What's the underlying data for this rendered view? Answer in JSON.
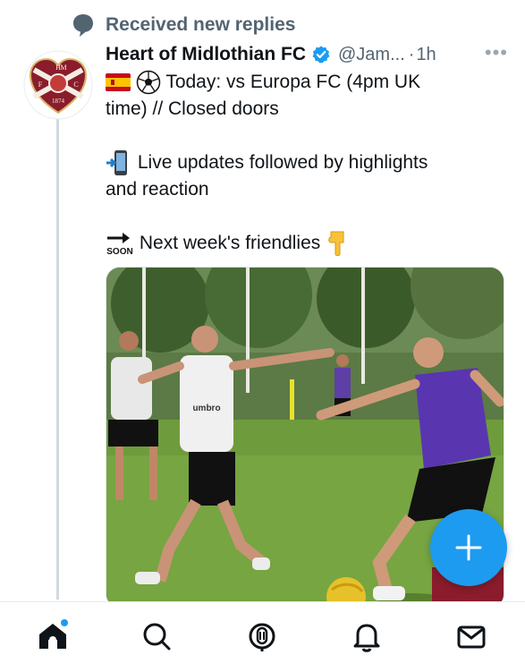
{
  "notification": {
    "text": "Received new replies",
    "icon": "speech-bubble-icon"
  },
  "tweet": {
    "author_name": "Heart of Midlothian FC",
    "verified": true,
    "handle": "@Jam...",
    "time": "1h",
    "separator": "·",
    "more_label": "•••",
    "lines": [
      "Today: vs Europa FC (4pm UK",
      "time) // Closed doors",
      "Live updates followed by highlights",
      "and reaction",
      "Next week's friendlies"
    ],
    "emojis": [
      "spain-flag-icon",
      "soccer-ball-icon",
      "mobile-phone-arrow-icon",
      "soon-arrow-icon",
      "pointing-down-hand-icon"
    ],
    "soon_label": "SOON",
    "media": {
      "description": "Players training on a grass pitch",
      "bib_brand": "umbro"
    }
  },
  "avatar": {
    "crest_letters": [
      "H",
      "M",
      "F",
      "C"
    ],
    "year": "1874"
  },
  "fab": {
    "label": "+",
    "icon": "compose-plus-icon"
  },
  "tabbar": {
    "items": [
      {
        "name": "home",
        "icon": "home-icon",
        "has_badge": true
      },
      {
        "name": "search",
        "icon": "search-icon"
      },
      {
        "name": "spaces",
        "icon": "spaces-mic-icon"
      },
      {
        "name": "notifications",
        "icon": "bell-icon"
      },
      {
        "name": "messages",
        "icon": "mail-icon"
      }
    ]
  },
  "colors": {
    "accent": "#1d9bf0",
    "secondary_text": "#536471",
    "crest_maroon": "#8a1c2b"
  }
}
